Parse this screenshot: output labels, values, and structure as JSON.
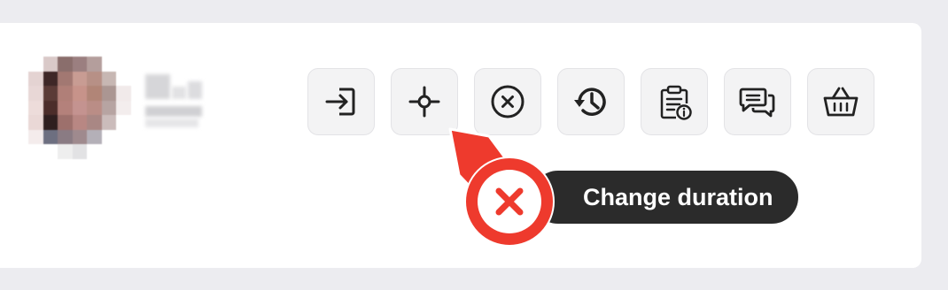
{
  "toolbar": {
    "actions": [
      {
        "name": "login-icon"
      },
      {
        "name": "crosshair-icon"
      },
      {
        "name": "cancel-circle-icon"
      },
      {
        "name": "history-icon"
      },
      {
        "name": "clipboard-info-icon"
      },
      {
        "name": "chat-bubbles-icon"
      },
      {
        "name": "basket-icon"
      }
    ]
  },
  "tooltip": {
    "text": "Change duration"
  },
  "colors": {
    "accent_red": "#ee3a2d",
    "tooltip_bg": "#2b2b2b",
    "button_bg": "#f3f3f4",
    "icon": "#222222",
    "page_bg": "#ececf0"
  }
}
